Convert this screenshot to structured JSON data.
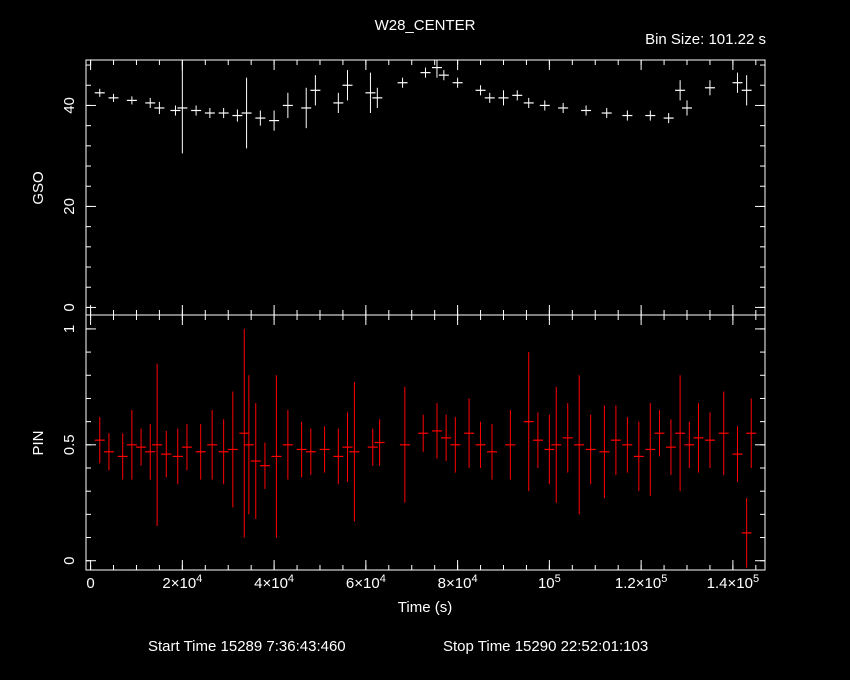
{
  "header": {
    "title": "W28_CENTER",
    "bin_size": "Bin Size: 101.22 s"
  },
  "footer": {
    "start_time": "Start Time 15289  7:36:43:460",
    "stop_time": "Stop Time 15290 22:52:01:103"
  },
  "colors": {
    "background": "#000000",
    "axes": "#ffffff",
    "gso_series": "#ffffff",
    "pin_series": "#ff0000"
  },
  "chart_data": [
    {
      "type": "scatter",
      "panel": "top",
      "ylabel": "GSO",
      "ylim": [
        -1.5,
        49
      ],
      "yticks": [
        0,
        20,
        40
      ],
      "ytick_labels": [
        "0",
        "20",
        "40"
      ],
      "xlim": [
        -1000,
        147000
      ],
      "series": [
        {
          "x": [
            2000,
            5000,
            9000,
            13000,
            15000,
            18500,
            20000,
            23000,
            26000,
            29000,
            32000,
            34000,
            37000,
            40000,
            43000,
            47000,
            49000,
            54000,
            56000,
            61000,
            62500,
            68000,
            73000,
            75500,
            77000,
            80000,
            85000,
            87000,
            90000,
            93000,
            95500,
            99000,
            103000,
            108000,
            112500,
            117000,
            122000,
            126000,
            128500,
            130000,
            135000,
            141000,
            143000
          ],
          "y": [
            42.5,
            41.5,
            41,
            40.5,
            39.5,
            39,
            39.5,
            39,
            38.5,
            38.5,
            38,
            38.5,
            37.5,
            37,
            40,
            39.5,
            43,
            40.5,
            44,
            42.5,
            41.5,
            44.5,
            46.5,
            47.5,
            46,
            44.5,
            43,
            41.5,
            41.5,
            42,
            40.5,
            40,
            39.5,
            39,
            38.5,
            38,
            38,
            37.5,
            43,
            39.5,
            43.5,
            44.5,
            43
          ],
          "errors": [
            0.8,
            0.8,
            0.8,
            1,
            1.2,
            1,
            9,
            1,
            1,
            1,
            1.2,
            7,
            1.5,
            2,
            2.5,
            4,
            3,
            2,
            3,
            4,
            2,
            1,
            1,
            2,
            1,
            1,
            1,
            1,
            1.5,
            1,
            1,
            1,
            1,
            1,
            1,
            1,
            1,
            1,
            2,
            1.5,
            1.5,
            2,
            3
          ]
        }
      ]
    },
    {
      "type": "scatter",
      "panel": "bottom",
      "ylabel": "PIN",
      "xlabel": "Time (s)",
      "ylim": [
        -0.04,
        1.06
      ],
      "yticks": [
        0,
        0.5,
        1
      ],
      "ytick_labels": [
        "0",
        "0.5",
        "1"
      ],
      "xlim": [
        -1000,
        147000
      ],
      "xticks": [
        0,
        20000,
        40000,
        60000,
        80000,
        100000,
        120000,
        140000
      ],
      "xtick_labels": [
        {
          "base": "0",
          "exp": ""
        },
        {
          "base": "2×10",
          "exp": "4"
        },
        {
          "base": "4×10",
          "exp": "4"
        },
        {
          "base": "6×10",
          "exp": "4"
        },
        {
          "base": "8×10",
          "exp": "4"
        },
        {
          "base": "10",
          "exp": "5"
        },
        {
          "base": "1.2×10",
          "exp": "5"
        },
        {
          "base": "1.4×10",
          "exp": "5"
        }
      ],
      "series": [
        {
          "x": [
            2000,
            4000,
            7000,
            9000,
            11000,
            13000,
            14500,
            16500,
            19000,
            21000,
            24000,
            26500,
            29000,
            31000,
            33500,
            34500,
            36000,
            38000,
            40500,
            43000,
            46000,
            48000,
            51000,
            54000,
            56000,
            57500,
            61500,
            63000,
            68500,
            72500,
            75500,
            77500,
            79500,
            82500,
            85000,
            87500,
            91500,
            95500,
            97500,
            100000,
            101500,
            104000,
            106500,
            109000,
            112000,
            114500,
            117000,
            119500,
            122000,
            124000,
            126500,
            128500,
            130500,
            132500,
            135000,
            138000,
            141000,
            143000,
            144000
          ],
          "y": [
            0.52,
            0.47,
            0.45,
            0.5,
            0.49,
            0.47,
            0.5,
            0.46,
            0.45,
            0.49,
            0.47,
            0.5,
            0.47,
            0.48,
            0.55,
            0.5,
            0.43,
            0.41,
            0.45,
            0.5,
            0.48,
            0.47,
            0.48,
            0.45,
            0.49,
            0.47,
            0.49,
            0.51,
            0.5,
            0.55,
            0.56,
            0.53,
            0.5,
            0.55,
            0.5,
            0.47,
            0.5,
            0.6,
            0.52,
            0.48,
            0.5,
            0.53,
            0.5,
            0.48,
            0.47,
            0.52,
            0.5,
            0.45,
            0.48,
            0.55,
            0.49,
            0.55,
            0.5,
            0.53,
            0.52,
            0.55,
            0.46,
            0.12,
            0.55
          ],
          "errors": [
            0.1,
            0.08,
            0.1,
            0.15,
            0.08,
            0.12,
            0.35,
            0.1,
            0.12,
            0.1,
            0.12,
            0.15,
            0.14,
            0.25,
            0.45,
            0.3,
            0.25,
            0.1,
            0.35,
            0.15,
            0.12,
            0.1,
            0.1,
            0.12,
            0.15,
            0.3,
            0.08,
            0.1,
            0.25,
            0.08,
            0.12,
            0.1,
            0.12,
            0.15,
            0.1,
            0.12,
            0.15,
            0.3,
            0.12,
            0.15,
            0.25,
            0.15,
            0.3,
            0.15,
            0.2,
            0.15,
            0.12,
            0.15,
            0.2,
            0.1,
            0.12,
            0.25,
            0.1,
            0.15,
            0.12,
            0.18,
            0.12,
            0.15,
            0.15
          ]
        }
      ]
    }
  ]
}
